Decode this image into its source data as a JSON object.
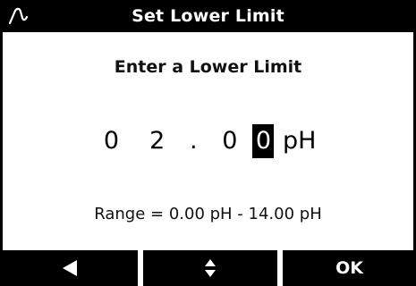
{
  "title": "Set Lower Limit",
  "prompt": "Enter a Lower Limit",
  "value": {
    "digits": [
      "0",
      "2",
      ".",
      "0",
      "0"
    ],
    "selected_index": 4,
    "unit": "pH"
  },
  "range_text": "Range = 0.00 pH - 14.00 pH",
  "softkeys": {
    "left_icon": "left-arrow-icon",
    "middle_icon": "up-down-arrows-icon",
    "right_label": "OK"
  },
  "icons": {
    "logo": "brand-logo-icon"
  }
}
